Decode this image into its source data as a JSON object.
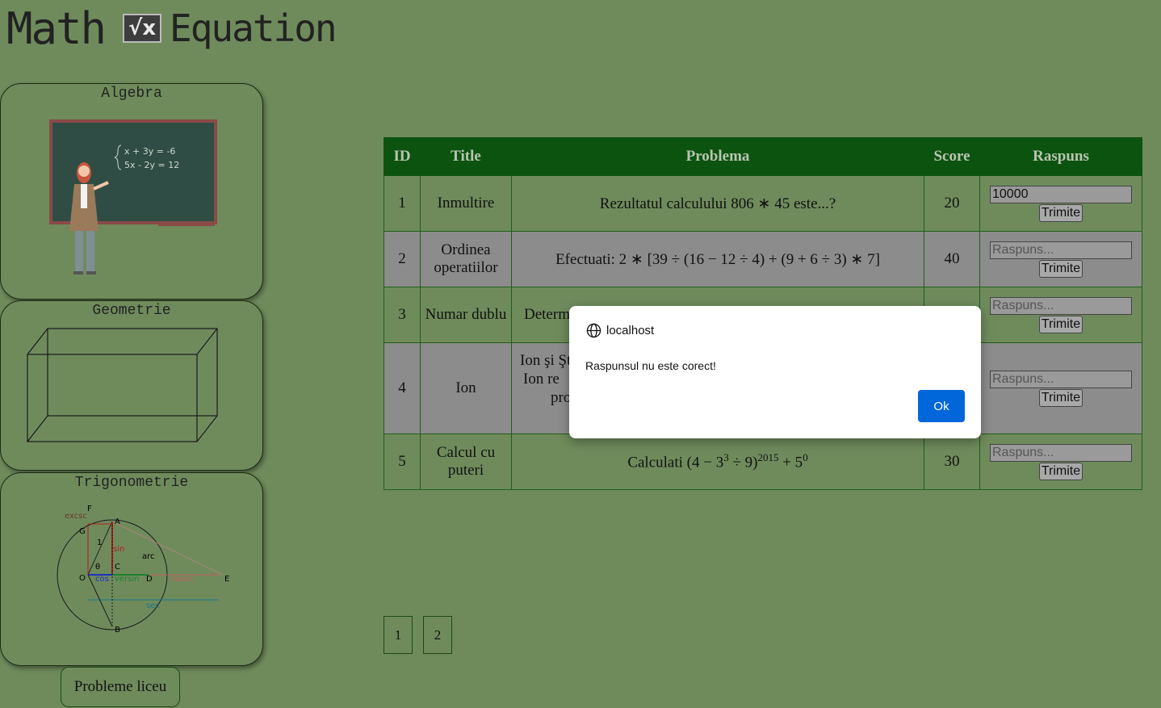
{
  "logo": {
    "word1": "Math",
    "badge": "√x",
    "word2": "Equation"
  },
  "sidebar": {
    "cards": [
      {
        "title": "Algebra"
      },
      {
        "title": "Geometrie"
      },
      {
        "title": "Trigonometrie"
      }
    ],
    "trig_labels": {
      "F": "F",
      "A": "A",
      "G": "G",
      "O": "O",
      "C": "C",
      "D": "D",
      "E": "E",
      "B": "B",
      "one": "1",
      "sin": "sin",
      "cos": "cos",
      "arc": "arc",
      "versin": "versin",
      "exsec": "exsec",
      "sec": "sec",
      "excsc": "excsc",
      "theta": "θ"
    },
    "algebra_board": {
      "line1": "x + 3y = -6",
      "line2": "5x - 2y = 12"
    },
    "liceu_button": "Probleme liceu"
  },
  "table": {
    "headers": [
      "ID",
      "Title",
      "Problema",
      "Score",
      "Raspuns"
    ],
    "rows": [
      {
        "id": "1",
        "title": "Inmultire",
        "problem": "Rezultatul calculului 806 ∗ 45 este...?",
        "score": "20",
        "answer_value": "10000"
      },
      {
        "id": "2",
        "title": "Ordinea operatiilor",
        "problem": "Efectuati: 2 ∗ [39 ÷ (16 − 12 ÷ 4) + (9 + 6 ÷ 3) ∗ 7]",
        "score": "40",
        "answer_value": ""
      },
      {
        "id": "3",
        "title": "Numar dublu",
        "problem": "Determ",
        "score": "",
        "answer_value": ""
      },
      {
        "id": "4",
        "title": "Ion",
        "problem_lines": [
          "Ion şi Şt",
          "Ion re",
          "pro"
        ],
        "score": "",
        "answer_value": ""
      },
      {
        "id": "5",
        "title": "Calcul cu puteri",
        "problem_parts": {
          "a": "Calculati (4 − 3",
          "b": "3",
          "c": " ÷ 9)",
          "d": "2015",
          "e": " + 5",
          "f": "0"
        },
        "score": "30",
        "answer_value": ""
      }
    ],
    "answer_placeholder": "Raspuns...",
    "submit_label": "Trimite"
  },
  "pagination": {
    "pages": [
      "1",
      "2"
    ]
  },
  "dialog": {
    "origin": "localhost",
    "message": "Raspunsul nu este corect!",
    "ok_label": "Ok"
  }
}
